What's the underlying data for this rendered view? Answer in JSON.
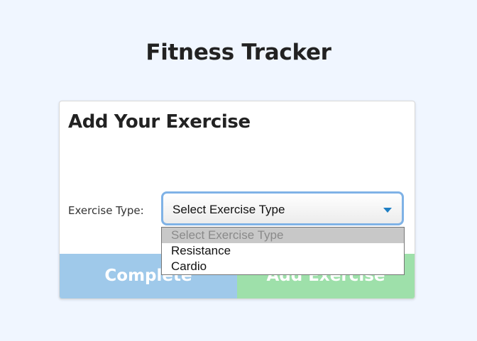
{
  "page": {
    "title": "Fitness Tracker"
  },
  "card": {
    "heading": "Add Your Exercise",
    "exercise_type_label": "Exercise Type:",
    "select": {
      "selected": "Select Exercise Type",
      "options": [
        "Select Exercise Type",
        "Resistance",
        "Cardio"
      ],
      "expanded": true
    },
    "buttons": {
      "complete_label": "Complete",
      "add_exercise_label": "Add Exercise"
    }
  },
  "colors": {
    "background": "#f0f6ff",
    "complete_button": "#9fc9ea",
    "add_exercise_button": "#9ee0aa",
    "select_focus_border": "#7fb2e6",
    "caret": "#1f7fc4",
    "highlighted_option": "#c8c8c8"
  },
  "icons": {
    "select_caret": "chevron-down-icon"
  }
}
